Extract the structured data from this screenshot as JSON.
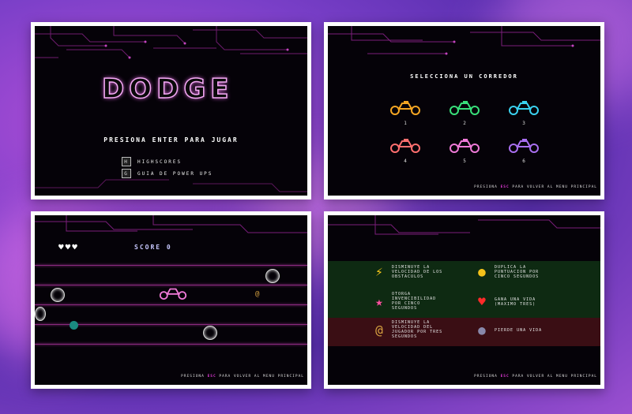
{
  "panel1": {
    "title": "DODGE",
    "press_enter": "PRESIONA ENTER PARA JUGAR",
    "options": [
      {
        "key": "H",
        "label": "HIGHSCORES"
      },
      {
        "key": "G",
        "label": "GUIA DE POWER UPS"
      }
    ]
  },
  "panel2": {
    "heading": "SELECCIONA UN CORREDOR",
    "runners": [
      {
        "num": "1",
        "color": "#f5a623"
      },
      {
        "num": "2",
        "color": "#38e07a"
      },
      {
        "num": "3",
        "color": "#3ad2f0"
      },
      {
        "num": "4",
        "color": "#ff6f6f"
      },
      {
        "num": "5",
        "color": "#f07ad8"
      },
      {
        "num": "6",
        "color": "#a96ff0"
      }
    ],
    "footer_pre": "PRESIONA",
    "footer_key": "ESC",
    "footer_post": "PARA VOLVER AL MENU PRINCIPAL"
  },
  "panel3": {
    "hearts": "♥♥♥",
    "score_label": "SCORE",
    "score_value": "0",
    "footer_pre": "PRESIONA",
    "footer_key": "ESC",
    "footer_post": "PARA VOLVER AL MENU PRINCIPAL"
  },
  "panel4": {
    "powerups": [
      {
        "icon": "⚡",
        "icon_name": "lightning-icon",
        "color": "#ffcc1a",
        "text": "DISMINUYE LA VELOCIDAD DE LOS OBSTACULOS"
      },
      {
        "icon": "●",
        "icon_name": "coin-icon",
        "color": "#f4c21a",
        "text": "DUPLICA LA PUNTUACION POR CINCO SEGUNDOS"
      },
      {
        "icon": "★",
        "icon_name": "star-icon",
        "color": "#ff4fa0",
        "text": "OTORGA INVENCIBILIDAD POR CINCO SEGUNDOS"
      },
      {
        "icon": "♥",
        "icon_name": "heart-icon",
        "color": "#ff2a2a",
        "text": "GANA UNA VIDA (MAXIMO TRES)"
      },
      {
        "icon": "@",
        "icon_name": "snail-icon",
        "color": "#d9a441",
        "text": "DISMINUYE LA VELOCIDAD DEL JUGADOR POR TRES SEGUNDOS"
      },
      {
        "icon": "●",
        "icon_name": "bomb-icon",
        "color": "#555577",
        "text": "PIERDE UNA VIDA"
      }
    ],
    "footer_pre": "PRESIONA",
    "footer_key": "ESC",
    "footer_post": "PARA VOLVER AL MENU PRINCIPAL"
  }
}
